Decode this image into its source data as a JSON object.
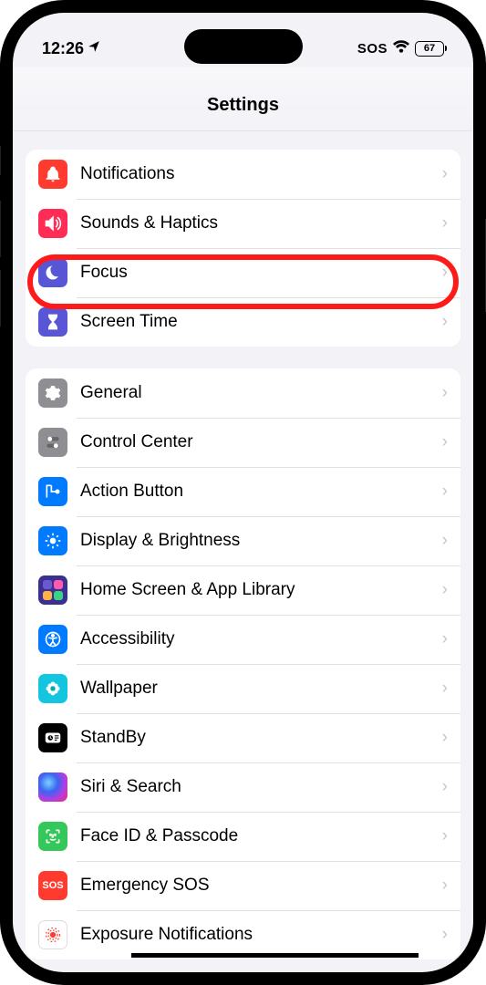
{
  "statusbar": {
    "time": "12:26",
    "sos": "SOS",
    "battery": "67"
  },
  "header": {
    "title": "Settings"
  },
  "group1": [
    {
      "key": "notifications",
      "label": "Notifications",
      "icon": "bell",
      "bg": "#ff3b30"
    },
    {
      "key": "sounds-haptics",
      "label": "Sounds & Haptics",
      "icon": "speaker",
      "bg": "#ff2d55"
    },
    {
      "key": "focus",
      "label": "Focus",
      "icon": "moon",
      "bg": "#5856d6",
      "highlighted": true
    },
    {
      "key": "screen-time",
      "label": "Screen Time",
      "icon": "hourglass",
      "bg": "#5856d6"
    }
  ],
  "group2": [
    {
      "key": "general",
      "label": "General",
      "icon": "gear",
      "bg": "#8e8e93"
    },
    {
      "key": "control-center",
      "label": "Control Center",
      "icon": "sliders",
      "bg": "#8e8e93"
    },
    {
      "key": "action-button",
      "label": "Action Button",
      "icon": "action",
      "bg": "#007aff"
    },
    {
      "key": "display-brightness",
      "label": "Display & Brightness",
      "icon": "sun",
      "bg": "#007aff"
    },
    {
      "key": "home-screen-app-library",
      "label": "Home Screen & App Library",
      "icon": "grid",
      "bg": "#5d3fd3"
    },
    {
      "key": "accessibility",
      "label": "Accessibility",
      "icon": "person",
      "bg": "#007aff"
    },
    {
      "key": "wallpaper",
      "label": "Wallpaper",
      "icon": "flower",
      "bg": "#00c7be"
    },
    {
      "key": "standby",
      "label": "StandBy",
      "icon": "clock",
      "bg": "#000000"
    },
    {
      "key": "siri-search",
      "label": "Siri & Search",
      "icon": "siri",
      "bg": "#000000"
    },
    {
      "key": "face-id-passcode",
      "label": "Face ID & Passcode",
      "icon": "face",
      "bg": "#34c759"
    },
    {
      "key": "emergency-sos",
      "label": "Emergency SOS",
      "icon": "sos",
      "bg": "#ff3b30"
    },
    {
      "key": "exposure-notifications",
      "label": "Exposure Notifications",
      "icon": "exposure",
      "bg": "#ffffff"
    }
  ]
}
